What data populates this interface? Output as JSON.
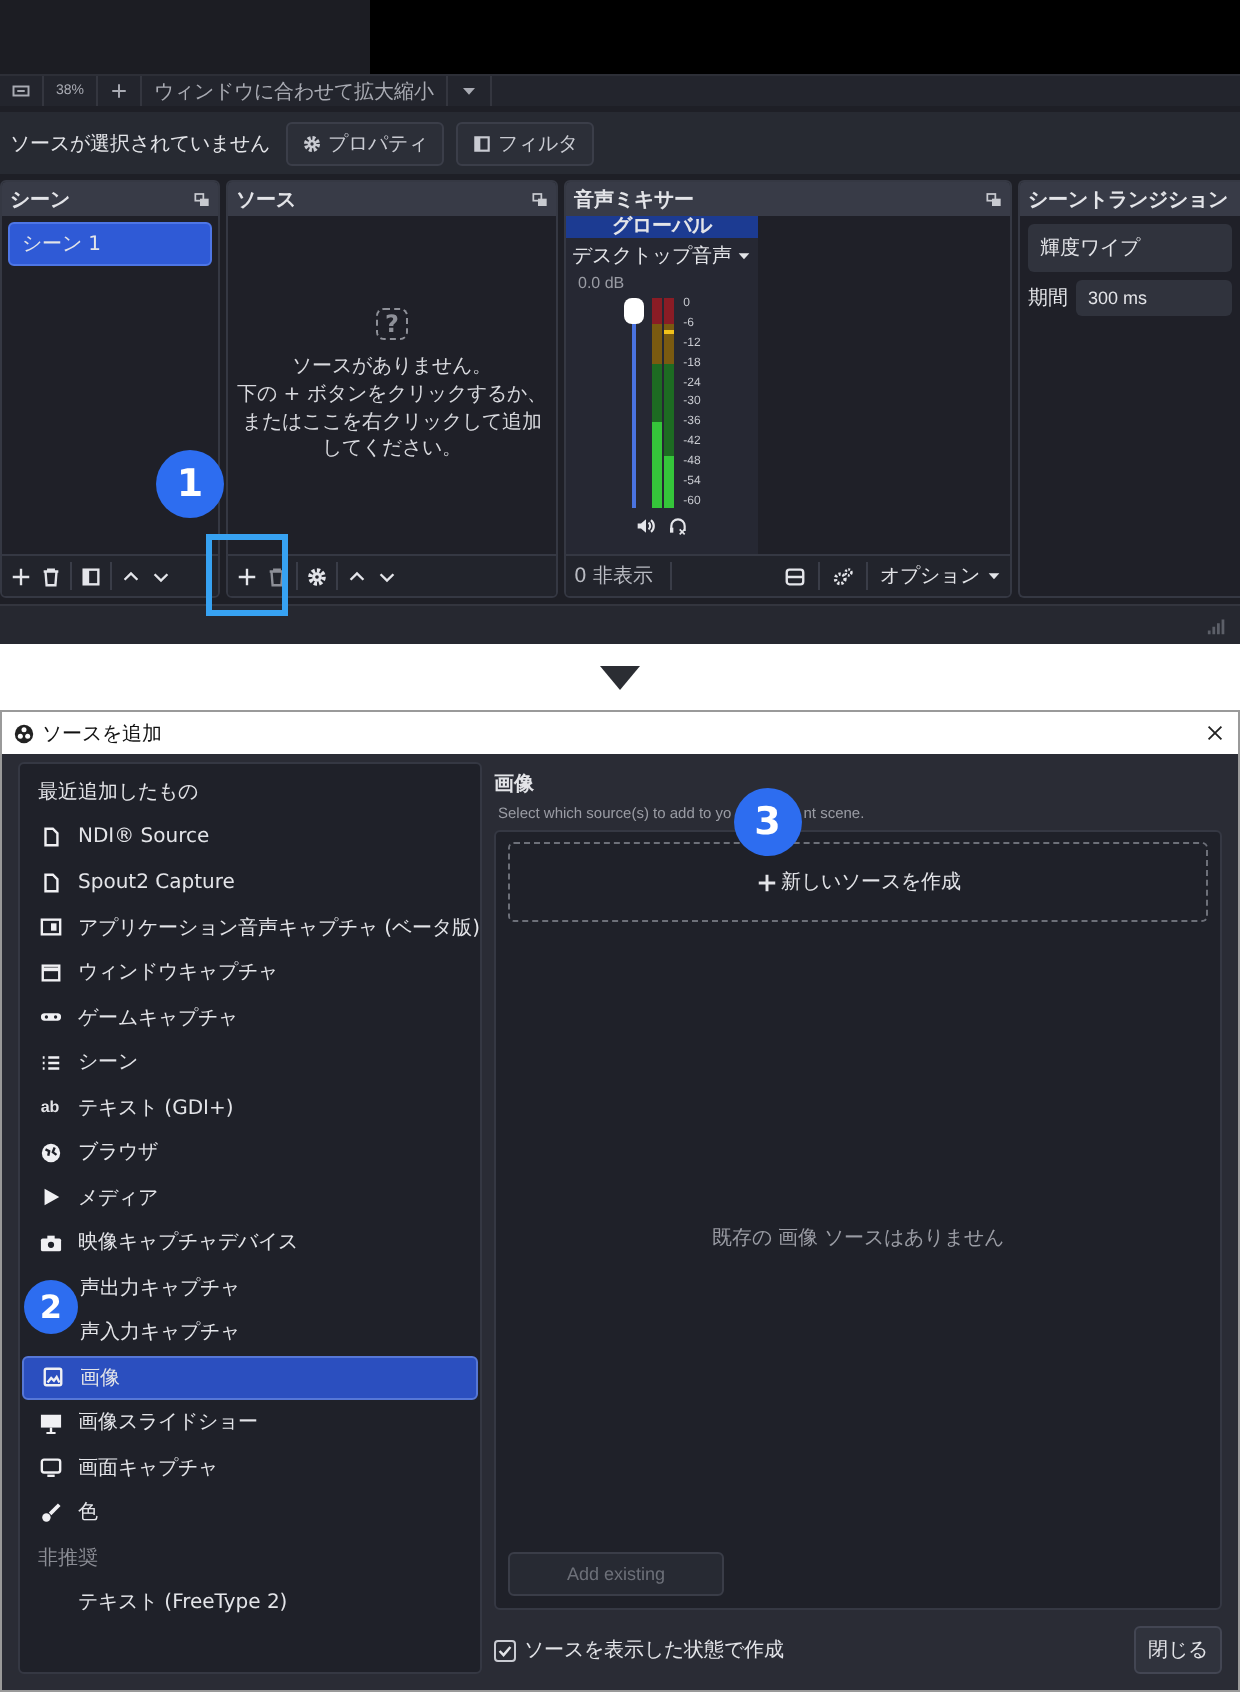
{
  "obs": {
    "zoom_bar": {
      "zoom": "38%",
      "fit": "ウィンドウに合わせて拡大縮小"
    },
    "toolbar": {
      "status": "ソースが選択されていません",
      "buttons": [
        "プロパティ",
        "フィルタ"
      ]
    },
    "scenes_dock": {
      "title": "シーン",
      "items": [
        {
          "label": "シーン 1",
          "selected": true
        }
      ]
    },
    "sources_dock": {
      "title": "ソース",
      "empty_icon": "?",
      "empty_lines": [
        "ソースがありません。",
        "下の + ボタンをクリックするか、",
        "またはここを右クリックして追加してください。"
      ]
    },
    "mixer_dock": {
      "title": "音声ミキサー",
      "global_tab": "グローバル",
      "channel": {
        "name": "デスクトップ音声",
        "volume": "0.0 dB",
        "level": 1,
        "scale": [
          "0",
          "-6",
          "-12",
          "-18",
          "-24",
          "-30",
          "-36",
          "-42",
          "-48",
          "-54",
          "-60"
        ]
      },
      "hidden_count": "0 非表示",
      "options": "オプション"
    },
    "transitions_dock": {
      "title": "シーントランジション",
      "transition": "輝度ワイプ",
      "duration_label": "期間",
      "duration": "300 ms"
    }
  },
  "callouts": [
    "1",
    "2",
    "3"
  ],
  "add_source_dialog": {
    "title": "ソースを追加",
    "items": [
      {
        "kind": "heading",
        "label": "最近追加したもの"
      },
      {
        "kind": "source",
        "label": "NDI® Source",
        "selected": false
      },
      {
        "kind": "source",
        "label": "Spout2 Capture",
        "selected": false
      },
      {
        "kind": "source",
        "label": "アプリケーション音声キャプチャ (ベータ版)",
        "selected": false
      },
      {
        "kind": "source",
        "label": "ウィンドウキャプチャ",
        "selected": false
      },
      {
        "kind": "source",
        "label": "ゲームキャプチャ",
        "selected": false
      },
      {
        "kind": "source",
        "label": "シーン",
        "selected": false
      },
      {
        "kind": "source",
        "label": "テキスト (GDI+)",
        "icon_text": "ab",
        "selected": false
      },
      {
        "kind": "source",
        "label": "ブラウザ",
        "selected": false
      },
      {
        "kind": "source",
        "label": "メディア",
        "selected": false
      },
      {
        "kind": "source",
        "label": "映像キャプチャデバイス",
        "selected": false
      },
      {
        "kind": "source",
        "label": "声出力キャプチャ",
        "selected": false
      },
      {
        "kind": "source",
        "label": "声入力キャプチャ",
        "selected": false
      },
      {
        "kind": "source",
        "label": "画像",
        "selected": true
      },
      {
        "kind": "source",
        "label": "画像スライドショー",
        "selected": false
      },
      {
        "kind": "source",
        "label": "画面キャプチャ",
        "selected": false
      },
      {
        "kind": "source",
        "label": "色",
        "selected": false
      },
      {
        "kind": "muted-heading",
        "label": "非推奨"
      },
      {
        "kind": "source",
        "label": "テキスト (FreeType 2)",
        "selected": false
      }
    ],
    "heading": "画像",
    "subtitle_parts": [
      "Select which source(s) to add to yo",
      "nt scene."
    ],
    "create_new": "新しいソースを作成",
    "empty_text": "既存の 画像 ソースはありません",
    "add_existing": {
      "label": "Add existing",
      "disabled": true
    },
    "visible_checkbox": {
      "label": "ソースを表示した状態で作成",
      "checked": true
    },
    "close": "閉じる"
  }
}
